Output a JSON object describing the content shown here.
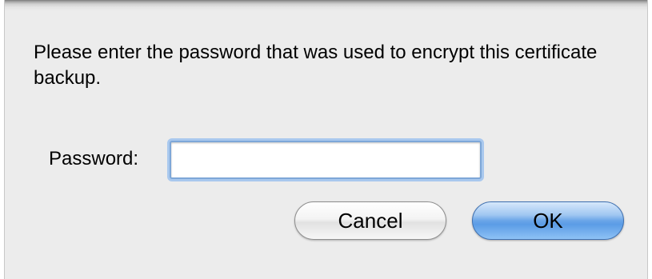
{
  "dialog": {
    "message": "Please enter the password that was used to encrypt this certificate backup.",
    "password_label": "Password:",
    "password_value": "",
    "cancel_label": "Cancel",
    "ok_label": "OK",
    "default_button": "OK",
    "focused_field": "password"
  },
  "colors": {
    "background": "#ececec",
    "focus_ring": "#7ea7d8",
    "default_button": "#6aa5e8"
  }
}
